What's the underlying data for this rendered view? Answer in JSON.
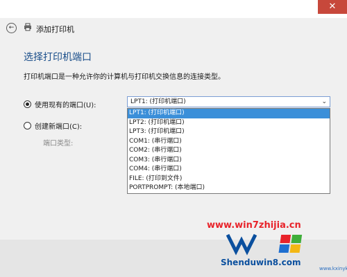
{
  "window": {
    "title": "添加打印机",
    "close_glyph": "✕",
    "back_glyph": "←"
  },
  "page": {
    "section_title": "选择打印机端口",
    "description": "打印机端口是一种允许你的计算机与打印机交换信息的连接类型。"
  },
  "options": {
    "use_existing_label": "使用现有的端口(U):",
    "use_existing_checked": true,
    "create_new_label": "创建新端口(C):",
    "create_new_checked": false,
    "port_type_label": "端口类型:"
  },
  "port_select": {
    "selected_value": "LPT1: (打印机端口)",
    "arrow_glyph": "⌄",
    "items": [
      {
        "label": "LPT1: (打印机端口)",
        "selected": true
      },
      {
        "label": "LPT2: (打印机端口)",
        "selected": false
      },
      {
        "label": "LPT3: (打印机端口)",
        "selected": false
      },
      {
        "label": "COM1: (串行端口)",
        "selected": false
      },
      {
        "label": "COM2: (串行端口)",
        "selected": false
      },
      {
        "label": "COM3: (串行端口)",
        "selected": false
      },
      {
        "label": "COM4: (串行端口)",
        "selected": false
      },
      {
        "label": "FILE: (打印到文件)",
        "selected": false
      },
      {
        "label": "PORTPROMPT: (本地端口)",
        "selected": false
      }
    ]
  },
  "watermark": {
    "top_text": "www.win7zhijia.cn",
    "bottom_text": "Shenduwin8.com",
    "side_text": "www.kxinyk.com"
  },
  "colors": {
    "accent": "#3b8fd9",
    "title_blue": "#1a4e8a",
    "close_red": "#c7483b"
  }
}
